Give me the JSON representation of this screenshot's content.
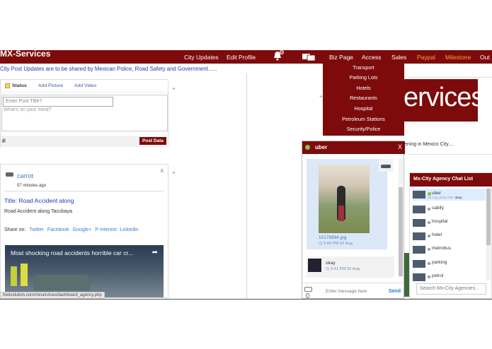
{
  "header": {
    "brand": "MX-Services",
    "nav": [
      "City Updates",
      "Edit Profile",
      "Biz Page",
      "Access",
      "Sales",
      "Paypal",
      "Milestone",
      "Out"
    ]
  },
  "ticker": "City Post Updates are to be shared by Mexican Police, Road Safety and Government......",
  "postbox": {
    "tabs": [
      "Status",
      "Add Picture",
      "Add Video"
    ],
    "title_placeholder": "Enter Post Title?",
    "body_placeholder": "What's on your mind?",
    "post_button": "Post Data"
  },
  "feed": {
    "user": "carrot",
    "time": "57 minutes ago",
    "close": "X",
    "title": "Title: Road Accident along",
    "body": "Road Accident along Tacubaya",
    "share_label": "Share on:",
    "share": [
      "Twitter",
      "Facebook",
      "Google+",
      "P-Interest",
      "Linkedin"
    ],
    "video_title": "Most shocking road accidents horrible car cr..."
  },
  "status_url": "fredsolution.com/mxservices/dashboard_agency.php",
  "dropdown": {
    "items": [
      "Transport",
      "Parking Lots",
      "Hotels",
      "Restaurants",
      "Hospital",
      "Petroleum Stations",
      "Security/Police"
    ]
  },
  "banner": {
    "text": "ervices",
    "news": "ening in Mexico City...."
  },
  "chat": {
    "name": "uber",
    "close": "X",
    "file_name": "10176994.jpg",
    "file_time": "3:49 PM 02 Aug",
    "msg_text": "okay",
    "msg_time": "3:41 PM 02 Aug",
    "input_placeholder": "Enter message here",
    "send": "Send"
  },
  "agency": {
    "title": "Mx-City Agency Chat List",
    "items": [
      {
        "name": "uber",
        "sub_time": "02 Aug 2016 PM",
        "sub_msg": "okay",
        "online": true
      },
      {
        "name": "cabify"
      },
      {
        "name": "hospital"
      },
      {
        "name": "hotel"
      },
      {
        "name": "metrobus"
      },
      {
        "name": "parking"
      },
      {
        "name": "petrol"
      }
    ],
    "search_placeholder": "Search Mx-City Agencies..."
  },
  "colors": {
    "brand": "#7d0b0b",
    "link": "#3b7fc4",
    "accent_orange": "#ffa534",
    "online": "#7ec843"
  }
}
